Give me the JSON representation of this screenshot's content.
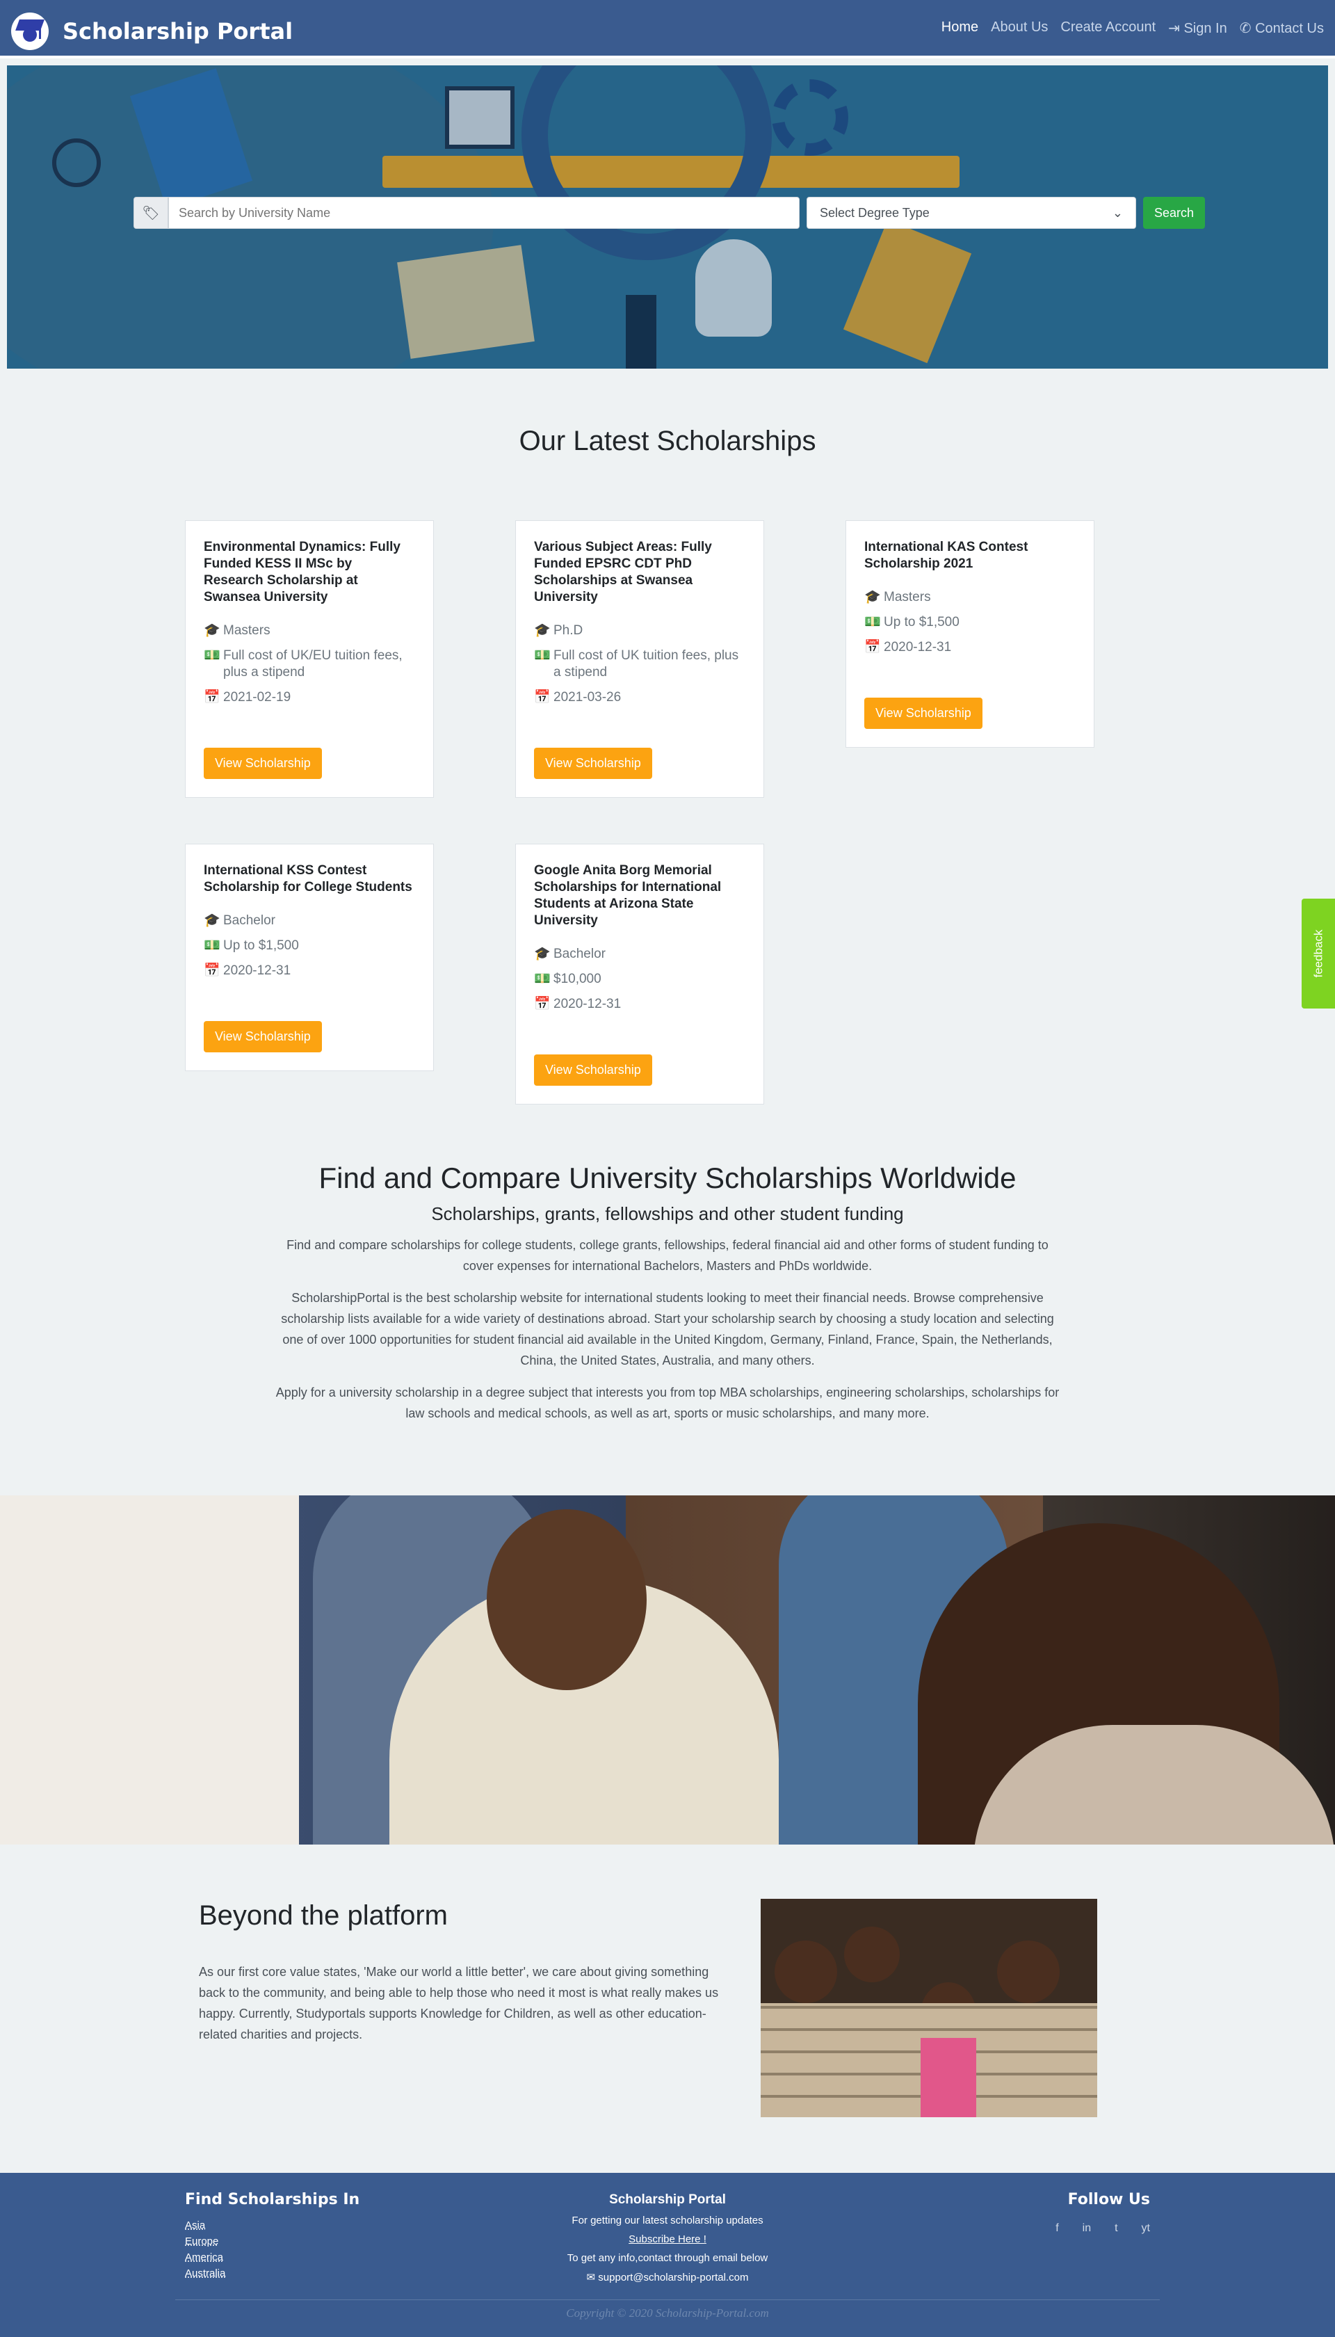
{
  "nav": {
    "brand": "Scholarship Portal",
    "links": [
      "Home",
      "About Us",
      "Create Account",
      "Sign In",
      "Contact Us"
    ]
  },
  "search": {
    "placeholder": "Search by University Name",
    "degree_select": "Select Degree Type",
    "button": "Search"
  },
  "latest": {
    "title": "Our Latest Scholarships",
    "cards": [
      {
        "title": "Environmental Dynamics: Fully Funded KESS II MSc by Research Scholarship at Swansea University",
        "degree": "Masters",
        "amount": "Full cost of UK/EU tuition fees, plus a stipend",
        "date": "2021-02-19",
        "button": "View Scholarship"
      },
      {
        "title": "Various Subject Areas: Fully Funded EPSRC CDT PhD Scholarships at Swansea University",
        "degree": "Ph.D",
        "amount": "Full cost of UK tuition fees, plus a stipend",
        "date": "2021-03-26",
        "button": "View Scholarship"
      },
      {
        "title": "International KAS Contest Scholarship 2021",
        "degree": "Masters",
        "amount": "Up to $1,500",
        "date": "2020-12-31",
        "button": "View Scholarship"
      },
      {
        "title": "International KSS Contest Scholarship for College Students",
        "degree": "Bachelor",
        "amount": "Up to $1,500",
        "date": "2020-12-31",
        "button": "View Scholarship"
      },
      {
        "title": "Google Anita Borg Memorial Scholarships for International Students at Arizona State University",
        "degree": "Bachelor",
        "amount": "$10,000",
        "date": "2020-12-31",
        "button": "View Scholarship"
      }
    ]
  },
  "about": {
    "title": "Find and Compare University Scholarships Worldwide",
    "subtitle": "Scholarships, grants, fellowships and other student funding",
    "p1": "Find and compare scholarships for college students, college grants, fellowships, federal financial aid and other forms of student funding to cover expenses for international Bachelors, Masters and PhDs worldwide.",
    "p2": "ScholarshipPortal is the best scholarship website for international students looking to meet their financial needs. Browse comprehensive scholarship lists available for a wide variety of destinations abroad. Start your scholarship search by choosing a study location and selecting one of over 1000 opportunities for student financial aid available in the United Kingdom, Germany, Finland, France, Spain, the Netherlands, China, the United States, Australia, and many others.",
    "p3": "Apply for a university scholarship in a degree subject that interests you from top MBA scholarships, engineering scholarships, scholarships for law schools and medical schools, as well as art, sports or music scholarships, and many more."
  },
  "beyond": {
    "title": "Beyond the platform",
    "text": "As our first core value states, 'Make our world a little better', we care about giving something back to the community, and being able to help those who need it most is what really makes us happy. Currently, Studyportals supports Knowledge for Children, as well as other education-related charities and projects."
  },
  "footer": {
    "find_title": "Find Scholarships In",
    "regions": [
      "Asia",
      "Europe",
      "America",
      "Australia"
    ],
    "portal_title": "Scholarship Portal",
    "updates_text": "For getting our latest scholarship updates",
    "subscribe": "Subscribe Here !",
    "contact_text": "To get any info,contact through email below",
    "email": "support@scholarship-portal.com",
    "follow_title": "Follow Us",
    "socials": [
      "f",
      "in",
      "t",
      "yt"
    ],
    "copyright": "Copyright © 2020 Scholarship-Portal.com"
  },
  "feedback": "feedback",
  "colors": {
    "nav": "#3a5b8f",
    "button_orange": "#fca311",
    "search_green": "#28a745",
    "feedback_green": "#7ed321"
  }
}
